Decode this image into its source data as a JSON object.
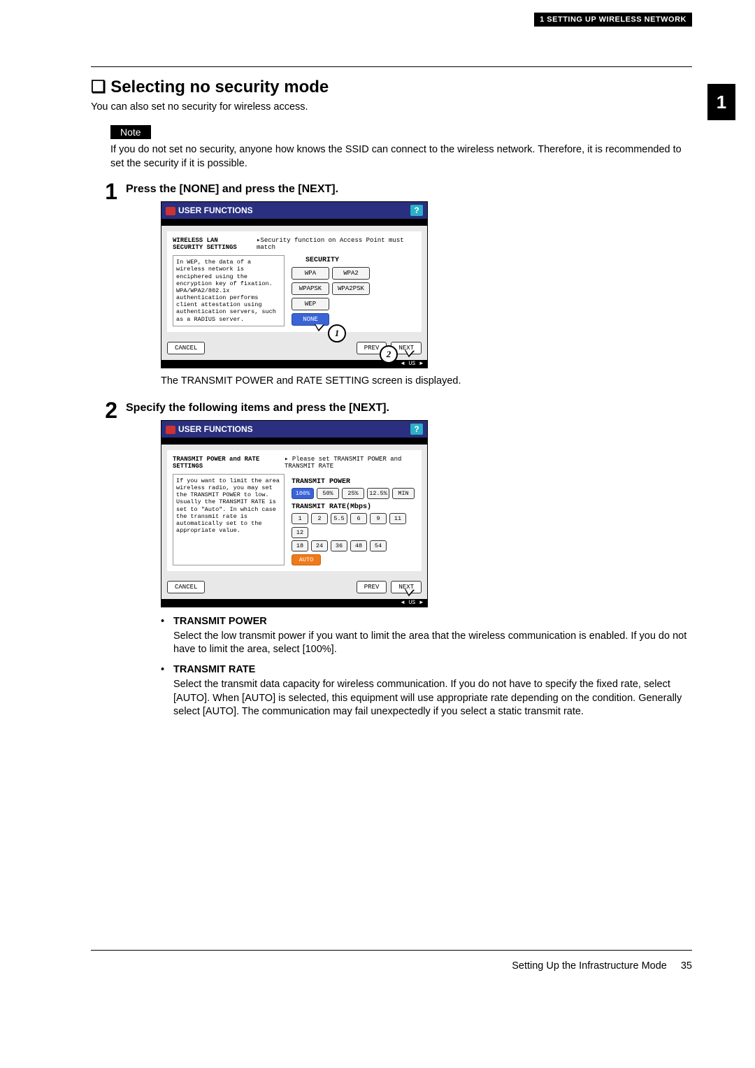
{
  "header": {
    "breadcrumb": "1 SETTING UP WIRELESS NETWORK",
    "side_tab": "1"
  },
  "section": {
    "bullet_glyph": "❏",
    "title": "Selecting no security mode",
    "intro": "You can also set no security for wireless access.",
    "note_label": "Note",
    "note_text": "If you do not set no security, anyone how knows the SSID can connect to the wireless network.  Therefore, it is recommended to set the security if it is possible."
  },
  "steps": [
    {
      "num": "1",
      "title": "Press the [NONE] and press the [NEXT].",
      "after_caption": "The TRANSMIT POWER and RATE SETTING screen is displayed.",
      "screen": {
        "title": "USER FUNCTIONS",
        "help": "?",
        "header_left": "WIRELESS LAN SECURITY SETTINGS",
        "header_right": "▸Security function on Access Point must match",
        "left_text": "In WEP, the data of a wireless network is enciphered using the encryption key of fixation. WPA/WPA2/802.1x authentication performs client attestation using authentication servers, such as a RADIUS server.",
        "group_label": "SECURITY",
        "buttons": {
          "wpa": "WPA",
          "wpa2": "WPA2",
          "wpapsk": "WPAPSK",
          "wpa2psk": "WPA2PSK",
          "wep": "WEP",
          "none": "NONE"
        },
        "nav": {
          "cancel": "CANCEL",
          "prev": "PREV",
          "next": "NEXT"
        },
        "status": "US",
        "callouts": {
          "c1": "1",
          "c2": "2"
        }
      }
    },
    {
      "num": "2",
      "title": "Specify the following items and press the [NEXT].",
      "screen": {
        "title": "USER FUNCTIONS",
        "help": "?",
        "header_left": "TRANSMIT POWER and RATE SETTINGS",
        "header_right": "▸ Please set TRANSMIT POWER and TRANSMIT RATE",
        "left_text": "If you want to limit the area wireless radio, you may set the TRANSMIT POWER to low. Usually the TRANSMIT RATE is set to \"Auto\". In which case the transmit rate is automatically set to the appropriate value.",
        "tp_label": "TRANSMIT POWER",
        "power": {
          "p100": "100%",
          "p50": "50%",
          "p25": "25%",
          "p125": "12.5%",
          "min": "MIN"
        },
        "tr_label": "TRANSMIT RATE(Mbps)",
        "rates_row1": {
          "r1": "1",
          "r2": "2",
          "r55": "5.5",
          "r6": "6",
          "r9": "9",
          "r11": "11",
          "r12": "12"
        },
        "rates_row2": {
          "r18": "18",
          "r24": "24",
          "r36": "36",
          "r48": "48",
          "r54": "54",
          "auto": "AUTO"
        },
        "nav": {
          "cancel": "CANCEL",
          "prev": "PREV",
          "next": "NEXT"
        },
        "status": "US"
      }
    }
  ],
  "bullets": [
    {
      "title": "TRANSMIT POWER",
      "body": "Select the low transmit power if you want to limit the area that the wireless communication is enabled. If you do not have to limit the area, select [100%]."
    },
    {
      "title": "TRANSMIT RATE",
      "body": "Select the transmit data capacity for wireless communication.  If you do not have to specify the fixed rate, select [AUTO].  When [AUTO] is selected, this equipment will use appropriate rate depending on the condition.  Generally select [AUTO].  The communication may fail unexpectedly if you select a static transmit rate."
    }
  ],
  "footer": {
    "text": "Setting Up the Infrastructure Mode",
    "page": "35"
  }
}
